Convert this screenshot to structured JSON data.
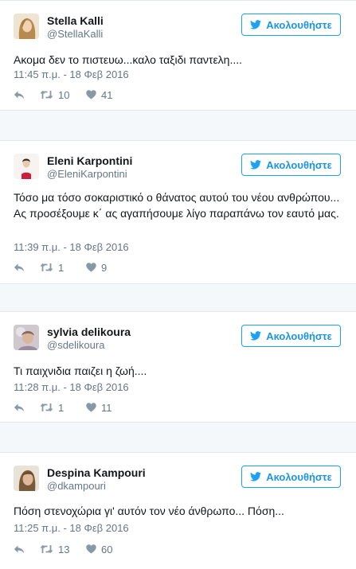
{
  "tweets": [
    {
      "name": "Stella Kalli",
      "handle": "@StellaKalli",
      "follow_label": "Ακολουθήστε",
      "text": "Ακομα δεν το πιστευω...καλο ταξιδι παντελη....",
      "timestamp": "11:45 π.μ. - 18 Φεβ 2016",
      "retweets": "10",
      "likes": "41"
    },
    {
      "name": "Eleni Karpontini",
      "handle": "@EleniKarpontini",
      "follow_label": "Ακολουθήστε",
      "text": "Τόσο μα τόσο σοκαριστικό ο θάνατος αυτού του νέου ανθρώπου... Ας προσέξουμε κ΄ ας αγαπήσουμε λίγο παραπάνω τον εαυτό μας.",
      "timestamp": "11:39 π.μ. - 18 Φεβ 2016",
      "retweets": "1",
      "likes": "9"
    },
    {
      "name": "sylvia delikoura",
      "handle": "@sdelikoura",
      "follow_label": "Ακολουθήστε",
      "text": "Τι παιχνιδια παιζει η ζωή....",
      "timestamp": "11:28 π.μ. - 18 Φεβ 2016",
      "retweets": "1",
      "likes": "11"
    },
    {
      "name": "Despina Kampouri",
      "handle": "@dkampouri",
      "follow_label": "Ακολουθήστε",
      "text": "Πόση στενοχώρια γι' αυτόν τον νέο άνθρωπο... Πόση...",
      "timestamp": "11:25 π.μ. - 18 Φεβ 2016",
      "retweets": "13",
      "likes": "60"
    }
  ],
  "icons": {
    "follow": "twitter-bird-icon",
    "reply": "reply-icon",
    "retweet": "retweet-icon",
    "like": "heart-icon"
  },
  "colors": {
    "accent": "#1da1f2",
    "muted": "#657786",
    "text": "#14171a",
    "background": "#f5f8fa"
  }
}
